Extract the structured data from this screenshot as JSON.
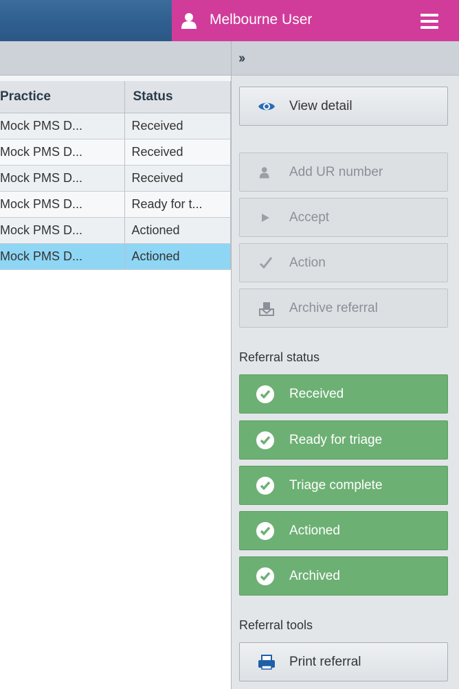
{
  "header": {
    "user_name": "Melbourne User",
    "user_icon": "user-icon",
    "menu_icon": "hamburger-menu-icon",
    "brand_color": "#d13c9a"
  },
  "grid": {
    "columns": [
      "Practice",
      "Status"
    ],
    "rows": [
      {
        "practice": "Mock PMS D...",
        "status": "Received"
      },
      {
        "practice": "Mock PMS D...",
        "status": "Received"
      },
      {
        "practice": "Mock PMS D...",
        "status": "Received"
      },
      {
        "practice": "Mock PMS D...",
        "status": "Ready for t..."
      },
      {
        "practice": "Mock PMS D...",
        "status": "Actioned"
      },
      {
        "practice": "Mock PMS D...",
        "status": "Actioned"
      }
    ],
    "selected_row": 5
  },
  "side": {
    "toggle_icon": "double-chevron-right-icon",
    "actions": {
      "view_detail": "View detail",
      "add_ur": "Add UR number",
      "accept": "Accept",
      "action": "Action",
      "archive": "Archive referral"
    },
    "status_label": "Referral status",
    "statuses": [
      "Received",
      "Ready for triage",
      "Triage complete",
      "Actioned",
      "Archived"
    ],
    "status_color": "#6db074",
    "tools_label": "Referral tools",
    "print": "Print referral"
  }
}
